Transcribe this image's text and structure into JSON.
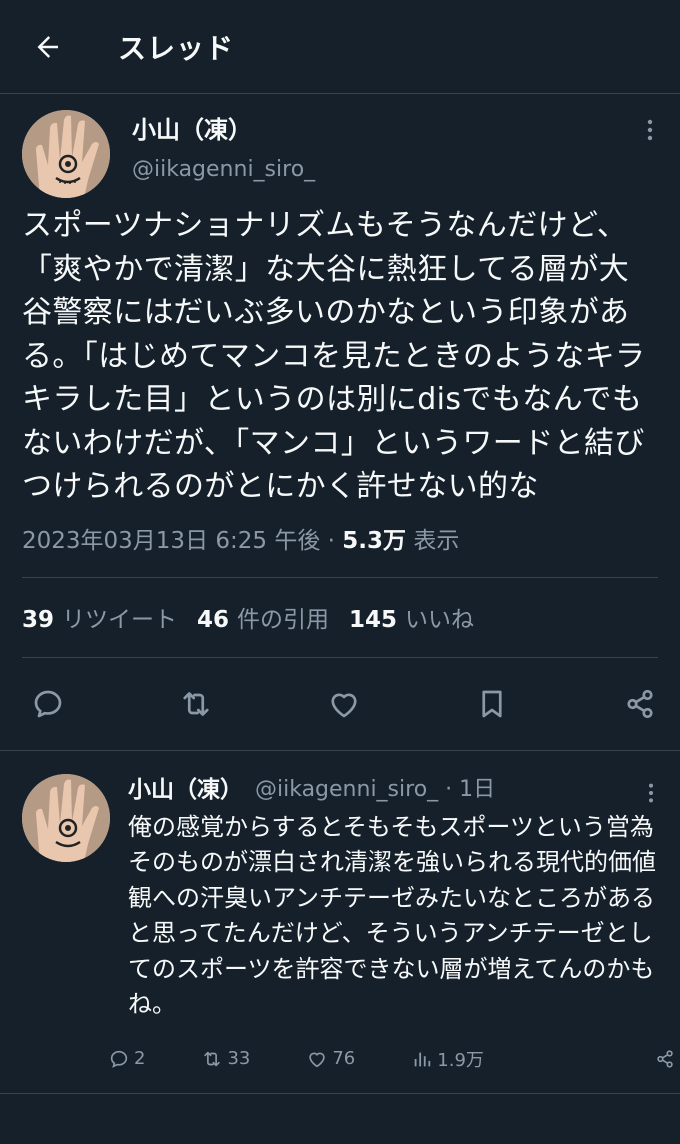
{
  "header": {
    "title": "スレッド"
  },
  "main_tweet": {
    "author_name": "小山（凍）",
    "author_handle": "@iikagenni_siro_",
    "text": "スポーツナショナリズムもそうなんだけど、「爽やかで清潔」な大谷に熱狂してる層が大谷警察にはだいぶ多いのかなという印象がある。「はじめてマンコを見たときのようなキラキラした目」というのは別にdisでもなんでもないわけだが、「マンコ」というワードと結びつけられるのがとにかく許せない的な",
    "timestamp": "2023年03月13日 6:25 午後 ·",
    "views_count": "5.3万",
    "views_label": "表示",
    "retweets_count": "39",
    "retweets_label": "リツイート",
    "quotes_count": "46",
    "quotes_label": "件の引用",
    "likes_count": "145",
    "likes_label": "いいね"
  },
  "reply": {
    "author_name": "小山（凍）",
    "author_handle": "@iikagenni_siro_ · 1日",
    "text": "俺の感覚からするとそもそもスポーツという営為そのものが漂白され清潔を強いられる現代的価値観への汗臭いアンチテーゼみたいなところがあると思ってたんだけど、そういうアンチテーゼとしてのスポーツを許容できない層が増えてんのかもね。",
    "replies": "2",
    "retweets": "33",
    "likes": "76",
    "views": "1.9万"
  },
  "colors": {
    "background": "#15202b",
    "text": "#f7f9f9",
    "muted": "#8b98a5",
    "border": "#38444d"
  }
}
